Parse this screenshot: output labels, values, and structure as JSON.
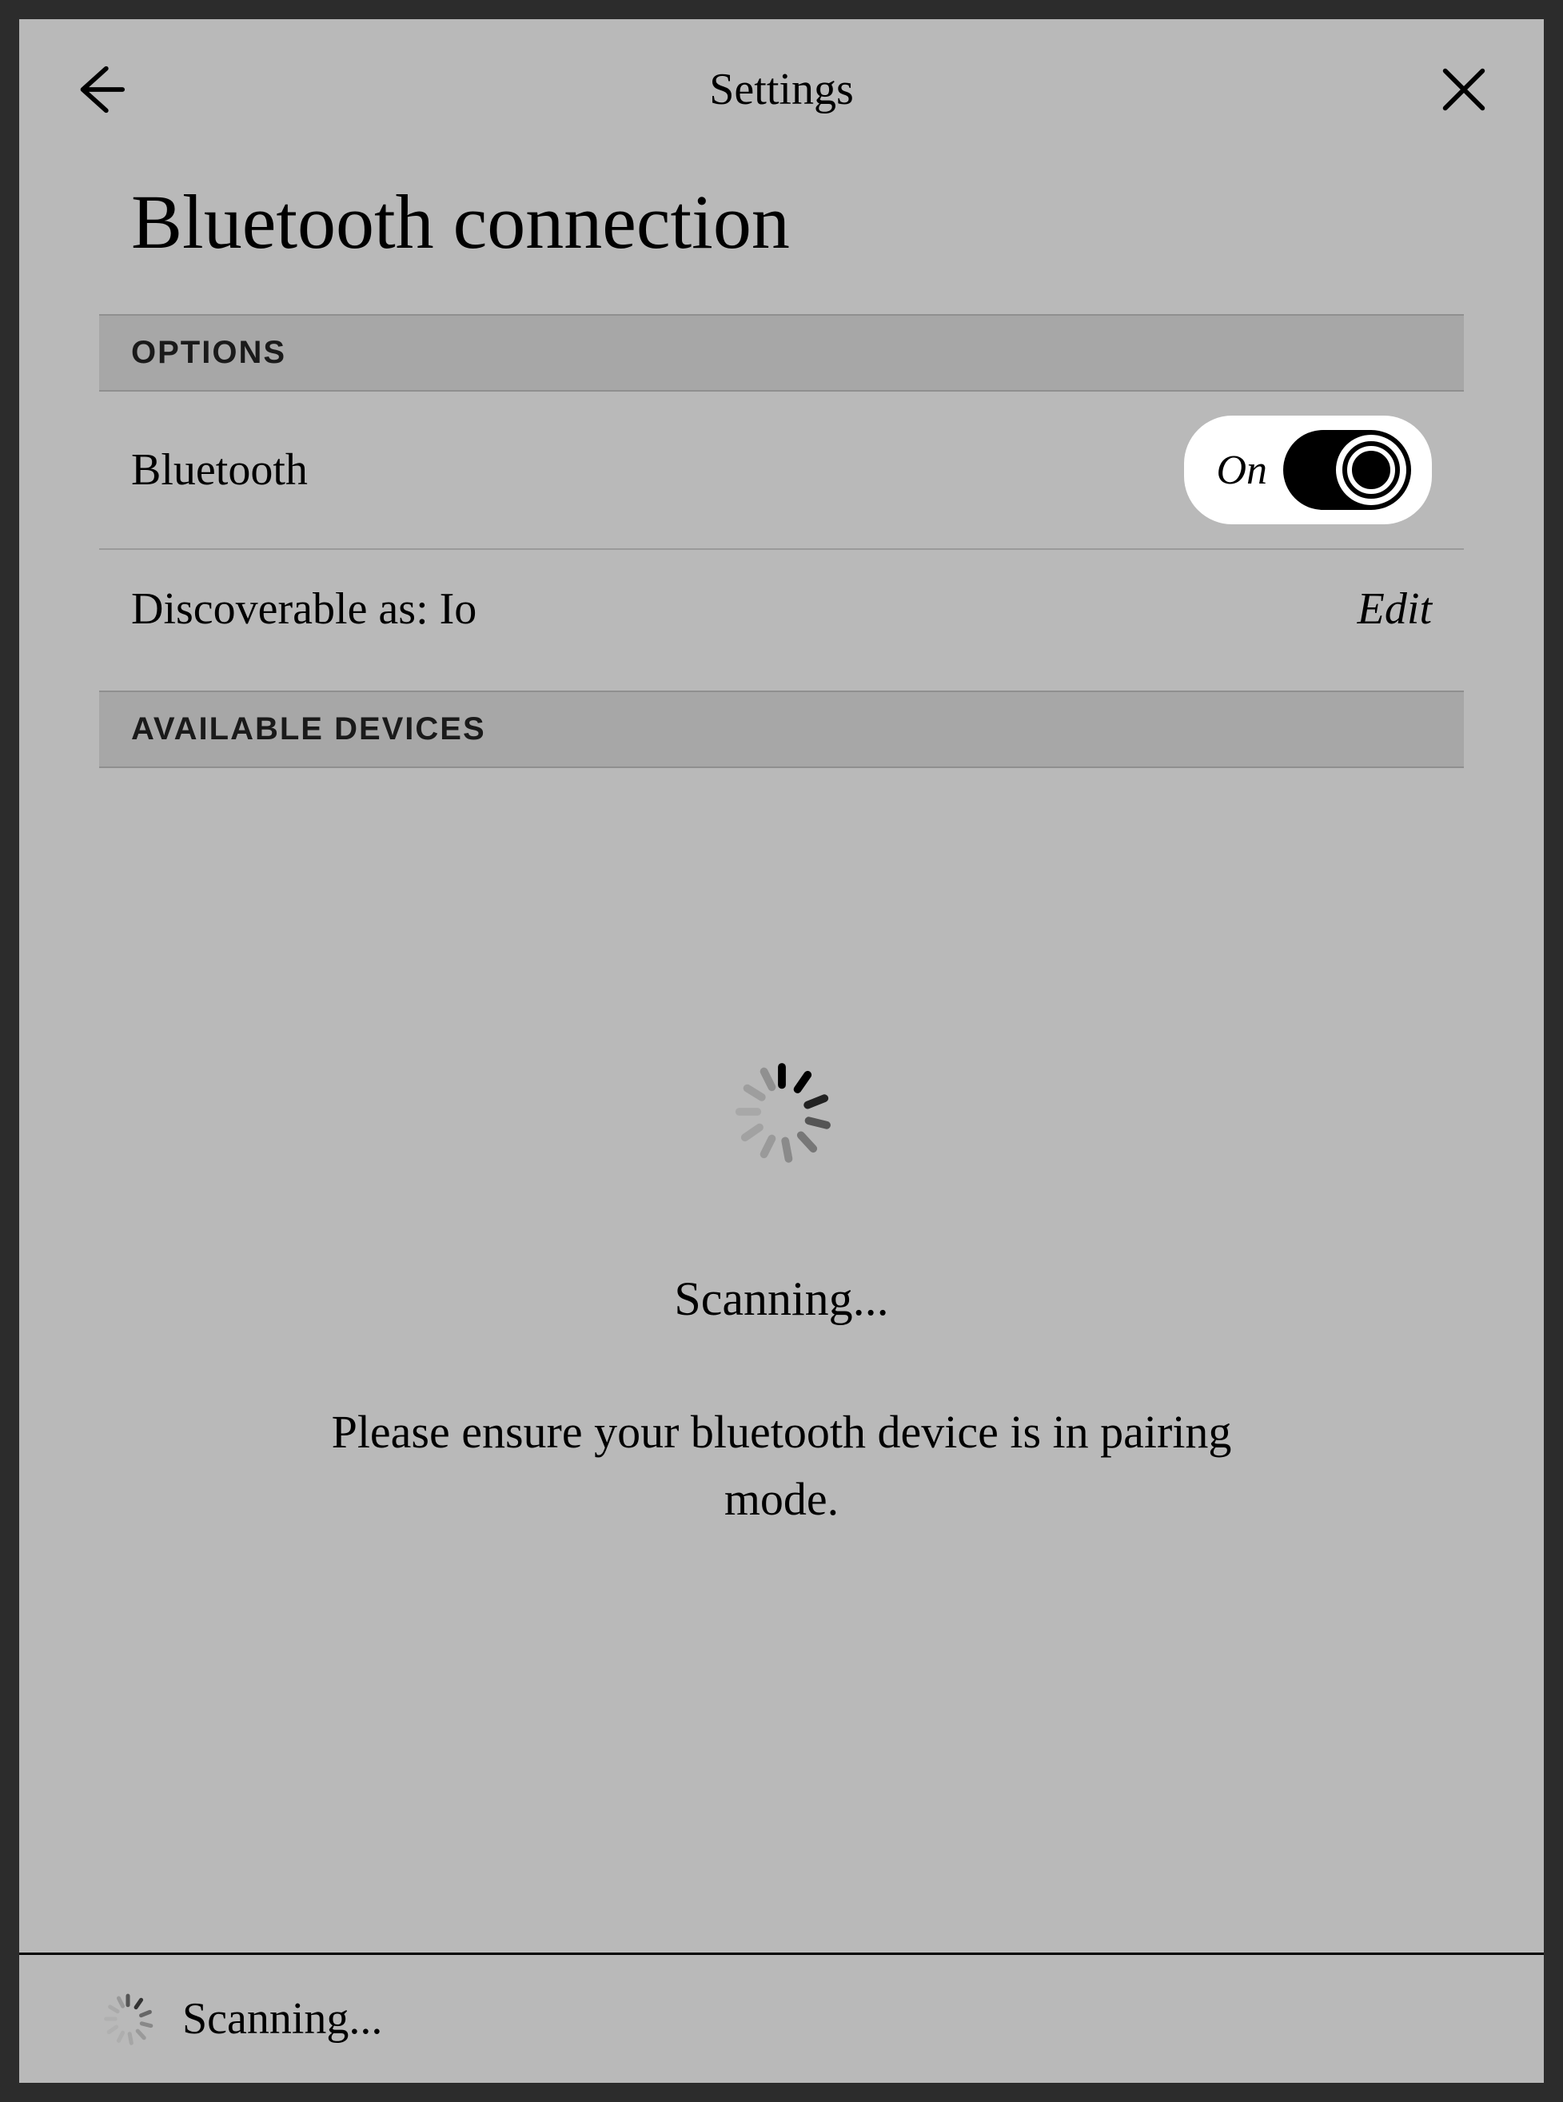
{
  "header": {
    "title": "Settings"
  },
  "page": {
    "title": "Bluetooth connection"
  },
  "sections": {
    "options_header": "OPTIONS",
    "available_header": "AVAILABLE DEVICES"
  },
  "bluetooth": {
    "label": "Bluetooth",
    "toggle_state_label": "On",
    "toggle_on": true
  },
  "discoverable": {
    "label_prefix": "Discoverable as: ",
    "device_name": "Io",
    "full_label": "Discoverable as: Io",
    "action_label": "Edit"
  },
  "scanning": {
    "status": "Scanning...",
    "message": "Please ensure your bluetooth device is in pairing mode."
  },
  "footer": {
    "status": "Scanning..."
  }
}
